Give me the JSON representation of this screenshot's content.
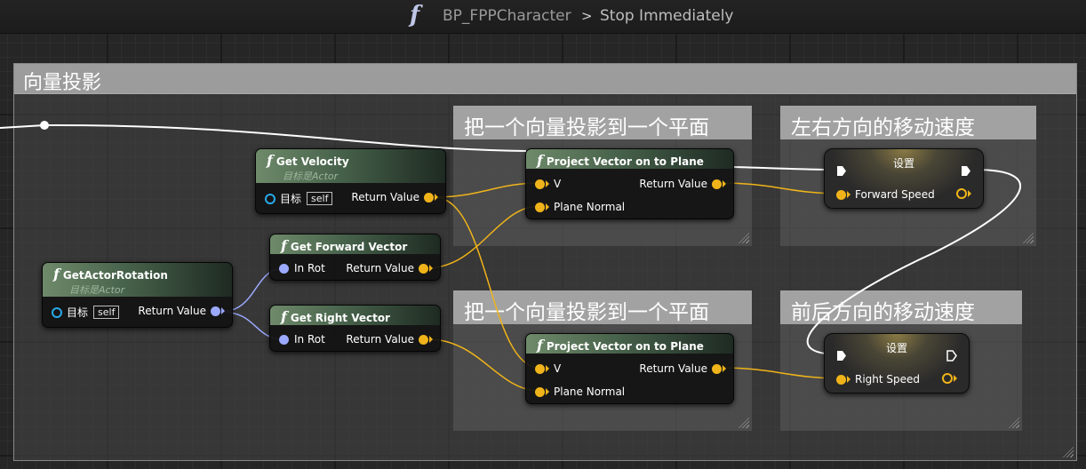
{
  "titlebar": {
    "fn_glyph": "f",
    "blueprint": "BP_FPPCharacter",
    "separator": ">",
    "function": "Stop Immediately"
  },
  "comments": {
    "outer": "向量投影",
    "project1": "把一个向量投影到一个平面",
    "leftright": "左右方向的移动速度",
    "project2": "把一个向量投影到一个平面",
    "frontback": "前后方向的移动速度"
  },
  "nodes": {
    "get_velocity": {
      "title": "Get Velocity",
      "subtitle": "目标是Actor",
      "target": "目标",
      "self": "self",
      "output": "Return Value"
    },
    "get_forward": {
      "title": "Get Forward Vector",
      "input": "In Rot",
      "output": "Return Value"
    },
    "get_right": {
      "title": "Get Right Vector",
      "input": "In Rot",
      "output": "Return Value"
    },
    "get_actor_rotation": {
      "title": "GetActorRotation",
      "subtitle": "目标是Actor",
      "target": "目标",
      "self": "self",
      "output": "Return Value"
    },
    "project1": {
      "title": "Project Vector on to Plane",
      "input_v": "V",
      "input_plane": "Plane Normal",
      "output": "Return Value"
    },
    "project2": {
      "title": "Project Vector on to Plane",
      "input_v": "V",
      "input_plane": "Plane Normal",
      "output": "Return Value"
    },
    "set_forward": {
      "title": "设置",
      "pin": "Forward Speed"
    },
    "set_right": {
      "title": "设置",
      "pin": "Right Speed"
    }
  },
  "colors": {
    "vector_pin": "#f0b41a",
    "rotator_pin": "#9ba9ff",
    "object_pin": "#29a9e8",
    "exec_wire": "#ffffff",
    "node_header": "#46614a",
    "comment_header": "#a2a2a2"
  },
  "icons": {
    "function": "function-f-icon",
    "exec_in": "exec-triangle-icon",
    "exec_out": "exec-triangle-icon"
  }
}
